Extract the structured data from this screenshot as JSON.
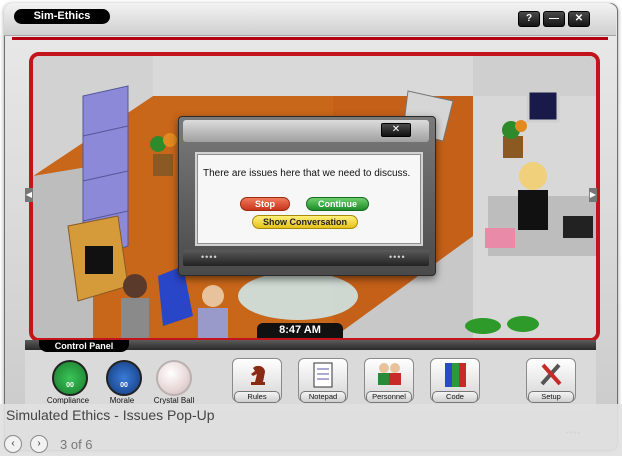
{
  "window": {
    "title": "Sim-Ethics",
    "buttons": {
      "help": "?",
      "minimize": "—",
      "close": "✕"
    }
  },
  "modal": {
    "close": "✕",
    "message": "There are issues here that we need to discuss.",
    "buttons": {
      "stop": "Stop",
      "continue": "Continue",
      "show_conversation": "Show Conversation"
    },
    "footer_dots_left": "••••",
    "footer_dots_right": "••••"
  },
  "clock": "8:47 AM",
  "control_panel": {
    "label": "Control Panel",
    "gauges": [
      {
        "label": "Compliance",
        "color": "#2aa04a",
        "value": "00"
      },
      {
        "label": "Morale",
        "color": "#1c5aa8",
        "value": "00"
      },
      {
        "label": "Crystal Ball",
        "color": "#f0e6e6"
      }
    ],
    "tools": [
      {
        "label": "Rules",
        "icon": "chess-knight-icon"
      },
      {
        "label": "Notepad",
        "icon": "notepad-icon"
      },
      {
        "label": "Personnel",
        "icon": "people-icon"
      },
      {
        "label": "Code",
        "icon": "books-icon"
      },
      {
        "label": "Setup",
        "icon": "tools-icon"
      }
    ],
    "corner_dots": "••••"
  },
  "caption": {
    "title": "Simulated Ethics - Issues Pop-Up",
    "slide_count": "3 of 6",
    "prev": "‹",
    "next": "›"
  }
}
